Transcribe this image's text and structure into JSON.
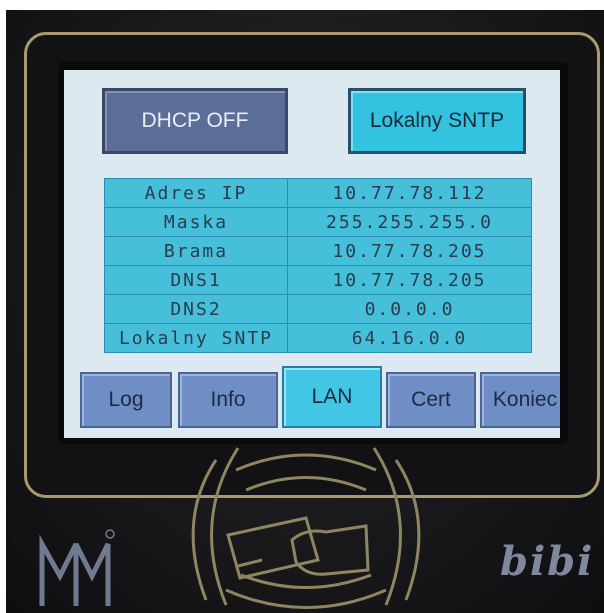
{
  "screen": {
    "buttons": {
      "dhcp_label": "DHCP OFF",
      "sntp_label": "Lokalny SNTP"
    },
    "network_rows": [
      {
        "label": "Adres IP",
        "value": "10.77.78.112"
      },
      {
        "label": "Maska",
        "value": "255.255.255.0"
      },
      {
        "label": "Brama",
        "value": "10.77.78.205"
      },
      {
        "label": "DNS1",
        "value": "10.77.78.205"
      },
      {
        "label": "DNS2",
        "value": "0.0.0.0"
      },
      {
        "label": "Lokalny SNTP",
        "value": "64.16.0.0"
      }
    ],
    "tabs": [
      {
        "label": "Log"
      },
      {
        "label": "Info"
      },
      {
        "label": "LAN"
      },
      {
        "label": "Cert"
      },
      {
        "label": "Koniec"
      }
    ],
    "active_tab": "LAN"
  },
  "device": {
    "logo_left": "MM-logo-icon",
    "logo_right": "bibi-logo-icon",
    "reader": "card-reader-icon",
    "logo_right_text": "bibi"
  },
  "colors": {
    "screen_bg": "#dce9f0",
    "table_cell": "#46bfdb",
    "button_off": "#5c6d98",
    "button_on": "#33c2e0",
    "tab_inactive": "#6f8ec6",
    "tab_active": "#41c6e6",
    "bezel_trim": "#a89a6e"
  }
}
